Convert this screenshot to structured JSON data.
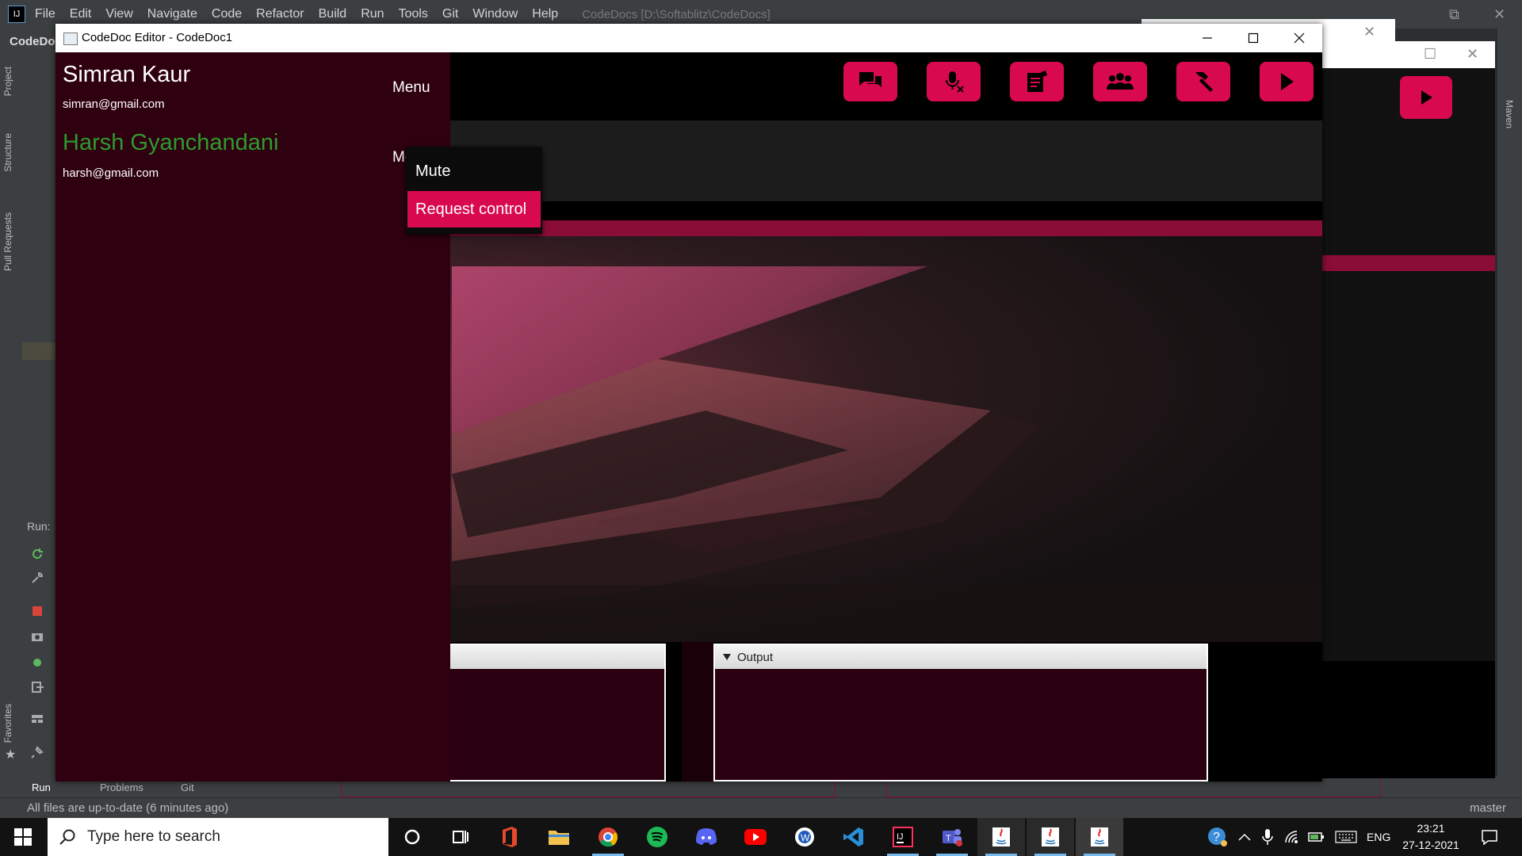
{
  "ide": {
    "menu": [
      "File",
      "Edit",
      "View",
      "Navigate",
      "Code",
      "Refactor",
      "Build",
      "Run",
      "Tools",
      "Git",
      "Window",
      "Help"
    ],
    "project_path": "CodeDocs [D:\\Softablitz\\CodeDocs]",
    "crumb": "CodeDo",
    "left_tabs": [
      "Project",
      "Structure",
      "Pull Requests",
      "Favorites"
    ],
    "right_tab": "Maven",
    "run_label": "Run:",
    "bottom_tabs": [
      "Run",
      "Problems",
      "Git"
    ],
    "status_message": "All files are up-to-date (6 minutes ago)",
    "branch": "master"
  },
  "window": {
    "title": "CodeDoc Editor - CodeDoc1"
  },
  "toolbar_icons": [
    "chat-icon",
    "mic-off-icon",
    "notes-icon",
    "people-icon",
    "hammer-icon",
    "play-icon"
  ],
  "sidebar": {
    "users": [
      {
        "name": "Simran Kaur",
        "email": "simran@gmail.com",
        "menu": "Menu",
        "color": "#ffffff"
      },
      {
        "name": "Harsh Gyanchandani",
        "email": "harsh@gmail.com",
        "menu": "Menu",
        "color": "#2e9b2e"
      }
    ]
  },
  "popup": {
    "mute": "Mute",
    "request_control": "Request control"
  },
  "panels": {
    "output": "Output"
  },
  "colors": {
    "accent": "#d9094f",
    "accent_dark": "#8a0d38",
    "sidebar_bg": "#2f0010"
  },
  "taskbar": {
    "search_placeholder": "Type here to search",
    "apps": [
      "cortana-icon",
      "task-view-icon",
      "office-icon",
      "file-explorer-icon",
      "chrome-icon",
      "spotify-icon",
      "discord-icon",
      "youtube-icon",
      "word-icon",
      "vscode-icon",
      "intellij-icon",
      "teams-icon",
      "java-icon",
      "java-icon",
      "java-icon"
    ],
    "language": "ENG",
    "time": "23:21",
    "date": "27-12-2021"
  }
}
